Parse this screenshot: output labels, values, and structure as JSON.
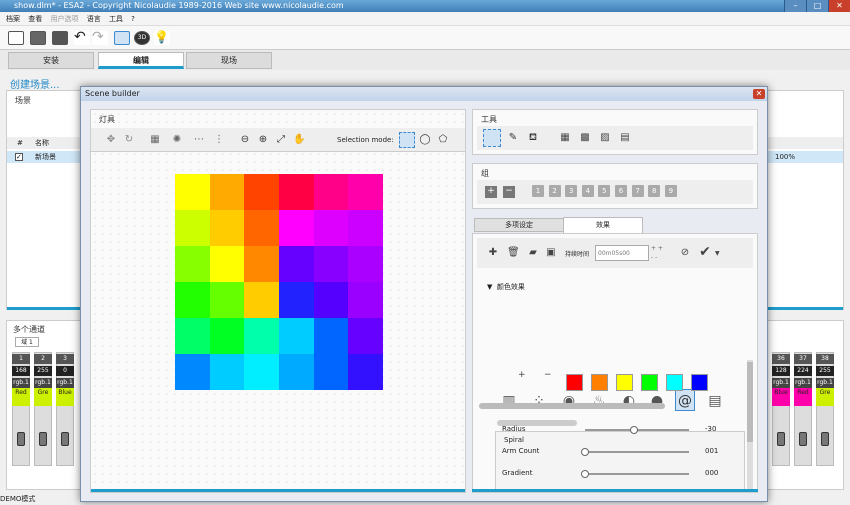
{
  "app": {
    "title": "show.dlm* - ESA2 - Copyright Nicolaudie 1989-2016 Web site www.nicolaudie.com"
  },
  "menu": [
    "档案",
    "查看",
    "用户选项",
    "语言",
    "工具",
    "?"
  ],
  "main_tabs": [
    {
      "label": "安装"
    },
    {
      "label": "编辑"
    },
    {
      "label": "现场"
    }
  ],
  "create_scene": "创建场景...",
  "scenes": {
    "title": "场景",
    "col_num": "#",
    "col_name": "名称",
    "row_name": "新场景",
    "row_pct": "100%"
  },
  "channels": {
    "title": "多个通道",
    "tab": "域 1",
    "left": [
      {
        "num": "1",
        "val": "168",
        "name": "rgb.1",
        "color": "Red",
        "hex": "#ccf000"
      },
      {
        "num": "2",
        "val": "255",
        "name": "rgb.1",
        "color": "Gre",
        "hex": "#ccf000"
      },
      {
        "num": "3",
        "val": "0",
        "name": "rgb.1",
        "color": "Blue",
        "hex": "#ccf000"
      }
    ],
    "right": [
      {
        "num": "36",
        "val": "128",
        "name": "rgb.1",
        "color": "Blue",
        "hex": "#ff00aa"
      },
      {
        "num": "37",
        "val": "224",
        "name": "rgb.1",
        "color": "Red",
        "hex": "#ff00aa"
      },
      {
        "num": "38",
        "val": "255",
        "name": "rgb.1",
        "color": "Gre",
        "hex": "#ccf000"
      }
    ]
  },
  "status": "DEMO模式",
  "scene_builder": {
    "title": "Scene builder",
    "fixtures_label": "灯具",
    "selection_mode": "Selection mode:",
    "tools_label": "工具",
    "group_label": "组",
    "group_numbers": [
      "1",
      "2",
      "3",
      "4",
      "5",
      "6",
      "7",
      "8",
      "9"
    ],
    "tabs": [
      {
        "label": "多项设定"
      },
      {
        "label": "效果"
      }
    ],
    "duration_label": "持续时间",
    "duration_value": "00m05s00",
    "color_effect_label": "颜色效果",
    "spiral": {
      "title": "Spiral",
      "colors": [
        "#ff0000",
        "#ff8000",
        "#ffff00",
        "#00ff00",
        "#00ffff",
        "#0000ff"
      ],
      "params": [
        {
          "label": "Radius",
          "value": "-30",
          "level": 0.47
        },
        {
          "label": "Arm Count",
          "value": "001",
          "level": 0.0
        },
        {
          "label": "Gradient",
          "value": "000",
          "level": 0.0
        }
      ]
    },
    "matrix_colors": [
      [
        "#ffff00",
        "#ffaa00",
        "#ff4400",
        "#ff0044",
        "#ff0088",
        "#ff00aa"
      ],
      [
        "#ccff00",
        "#ffcc00",
        "#ff6600",
        "#ff00ff",
        "#dd00ff",
        "#cc00ff"
      ],
      [
        "#88ff00",
        "#ffff00",
        "#ff8800",
        "#6600ff",
        "#8800ff",
        "#aa00ff"
      ],
      [
        "#22ff00",
        "#66ff00",
        "#ffcc00",
        "#2222ff",
        "#5500ff",
        "#9900ff"
      ],
      [
        "#00ff66",
        "#00ff22",
        "#00ffaa",
        "#00ccff",
        "#0066ff",
        "#6600ff"
      ],
      [
        "#0088ff",
        "#00ccff",
        "#00eeff",
        "#00aaff",
        "#0066ff",
        "#3311ff"
      ]
    ]
  }
}
